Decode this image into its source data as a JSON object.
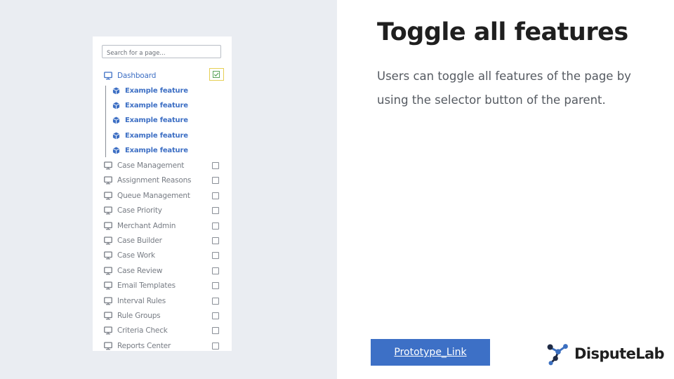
{
  "search": {
    "placeholder": "Search for a page..."
  },
  "parent": {
    "label": "Dashboard",
    "checked": true
  },
  "children": [
    "Example feature",
    "Example feature",
    "Example feature",
    "Example feature",
    "Example feature"
  ],
  "pages": [
    "Case Management",
    "Assignment Reasons",
    "Queue Management",
    "Case Priority",
    "Merchant Admin",
    "Case Builder",
    "Case Work",
    "Case Review",
    "Email Templates",
    "Interval Rules",
    "Rule Groups",
    "Criteria Check",
    "Reports Center"
  ],
  "heading": "Toggle all features",
  "description": "Users can toggle all features of the page by using the selector button of the parent.",
  "prototype_link": "Prototype_Link",
  "brand": "DisputeLab",
  "icons": {
    "page": "monitor-icon",
    "feature": "cube-icon",
    "checkbox": "checkbox-icon"
  },
  "colors": {
    "accent": "#3d70c6",
    "muted_text": "#777c84",
    "highlight": "#e6cf55",
    "check": "#5aa25a"
  }
}
